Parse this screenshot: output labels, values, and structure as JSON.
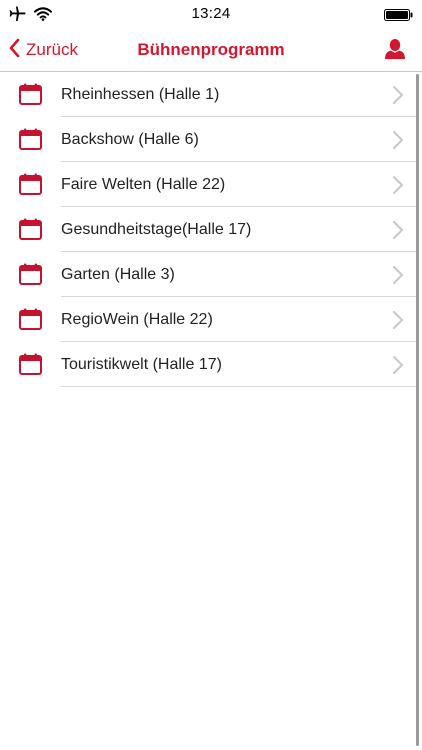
{
  "status_bar": {
    "time": "13:24",
    "icons": [
      "airplane-icon",
      "wifi-icon",
      "battery-icon"
    ]
  },
  "nav": {
    "back_label": "Zurück",
    "title": "Bühnenprogramm",
    "profile_icon": "user-icon"
  },
  "colors": {
    "accent": "#d4172e",
    "separator": "#d6d6d6",
    "chevron": "#c7c7cc"
  },
  "list": {
    "items": [
      {
        "label": "Rheinhessen (Halle 1)",
        "icon": "calendar-icon"
      },
      {
        "label": "Backshow (Halle 6)",
        "icon": "calendar-icon"
      },
      {
        "label": "Faire Welten (Halle 22)",
        "icon": "calendar-icon"
      },
      {
        "label": "Gesundheitstage(Halle 17)",
        "icon": "calendar-icon"
      },
      {
        "label": "Garten (Halle 3)",
        "icon": "calendar-icon"
      },
      {
        "label": "RegioWein (Halle 22)",
        "icon": "calendar-icon"
      },
      {
        "label": "Touristikwelt (Halle 17)",
        "icon": "calendar-icon"
      }
    ]
  }
}
